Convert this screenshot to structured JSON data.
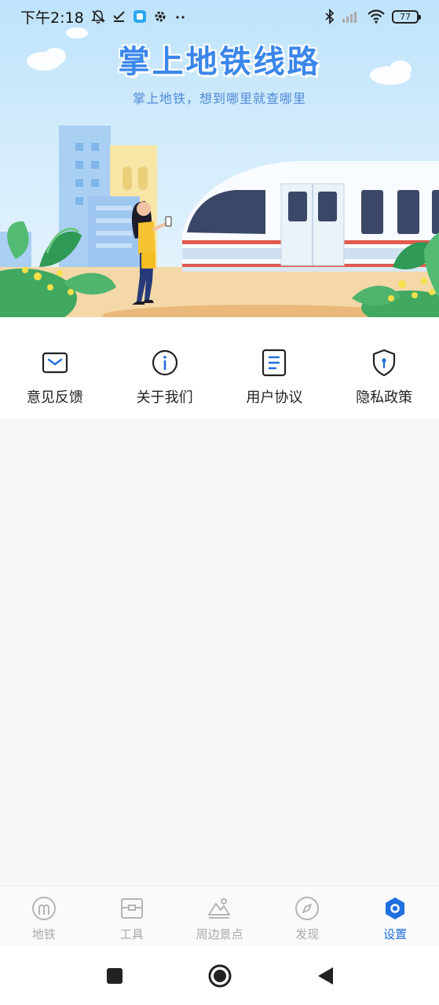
{
  "status": {
    "time": "下午2:18",
    "battery": "77"
  },
  "banner": {
    "title": "掌上地铁线路",
    "subtitle": "掌上地铁，想到哪里就查哪里"
  },
  "quick_menu": [
    {
      "label": "意见反馈",
      "icon": "mail-icon"
    },
    {
      "label": "关于我们",
      "icon": "info-icon"
    },
    {
      "label": "用户协议",
      "icon": "document-icon"
    },
    {
      "label": "隐私政策",
      "icon": "shield-icon"
    }
  ],
  "tabs": [
    {
      "label": "地铁",
      "icon": "metro-icon",
      "active": false
    },
    {
      "label": "工具",
      "icon": "toolbox-icon",
      "active": false
    },
    {
      "label": "周边景点",
      "icon": "mountain-icon",
      "active": false
    },
    {
      "label": "发现",
      "icon": "compass-icon",
      "active": false
    },
    {
      "label": "设置",
      "icon": "settings-hex-icon",
      "active": true
    }
  ],
  "colors": {
    "accent": "#1e6fe0",
    "title_blue": "#3b86ea",
    "inactive_tab": "#a9a9a9"
  }
}
